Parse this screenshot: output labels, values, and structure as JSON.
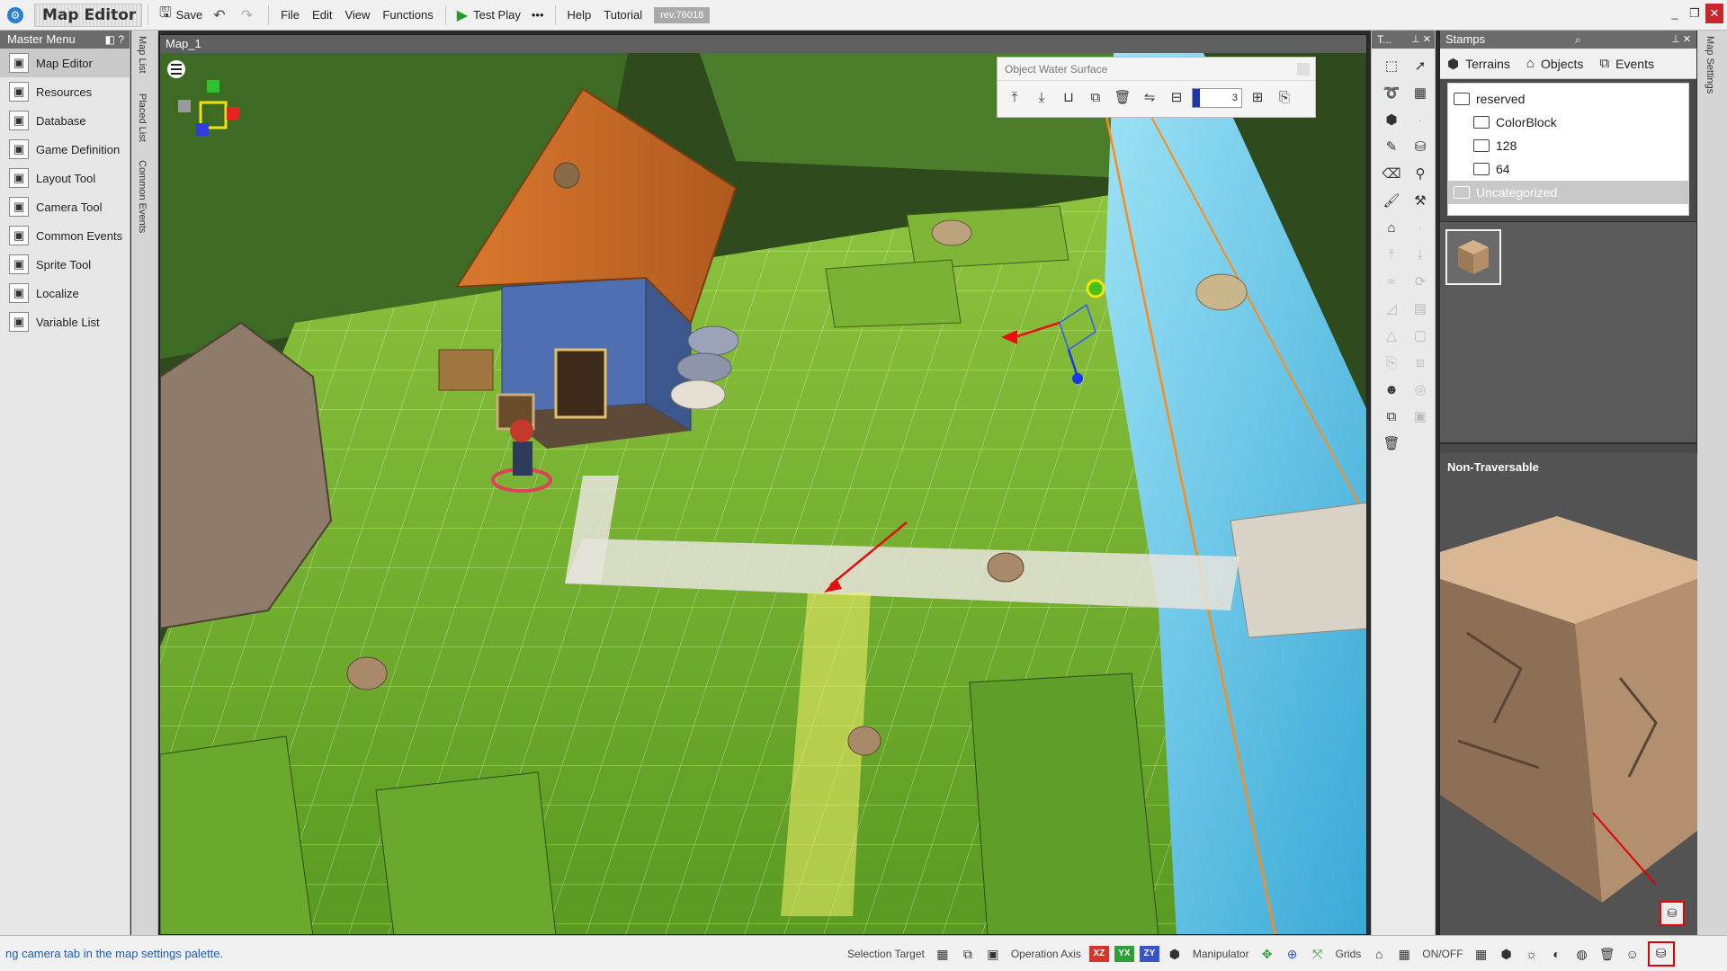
{
  "titlebar": {
    "app_title": "Map Editor",
    "save_label": "Save",
    "menus": [
      "File",
      "Edit",
      "View",
      "Functions"
    ],
    "test_play_label": "Test Play",
    "more_label": "•••",
    "help_label": "Help",
    "tutorial_label": "Tutorial",
    "revision": "rev.76018",
    "window_controls": [
      "_",
      "❐",
      "✕"
    ]
  },
  "master_menu": {
    "title": "Master Menu",
    "items": [
      {
        "label": "Map Editor",
        "icon": "map-icon",
        "selected": true
      },
      {
        "label": "Resources",
        "icon": "resources-icon"
      },
      {
        "label": "Database",
        "icon": "database-icon"
      },
      {
        "label": "Game Definition",
        "icon": "game-definition-icon"
      },
      {
        "label": "Layout Tool",
        "icon": "layout-icon"
      },
      {
        "label": "Camera Tool",
        "icon": "camera-icon"
      },
      {
        "label": "Common Events",
        "icon": "common-events-icon"
      },
      {
        "label": "Sprite Tool",
        "icon": "sprite-icon"
      },
      {
        "label": "Localize",
        "icon": "localize-icon"
      },
      {
        "label": "Variable List",
        "icon": "variable-icon"
      }
    ]
  },
  "vertical_tabs": [
    "Map List",
    "Placed List",
    "Common Events"
  ],
  "viewport": {
    "title": "Map_1",
    "water_panel": {
      "title": "Object Water Surface",
      "value": "3"
    }
  },
  "tools_panel": {
    "title": "T..."
  },
  "stamps": {
    "title": "Stamps",
    "tabs": [
      {
        "label": "Terrains",
        "icon": "terrain-icon"
      },
      {
        "label": "Objects",
        "icon": "objects-icon"
      },
      {
        "label": "Events",
        "icon": "events-icon"
      }
    ],
    "tree": [
      {
        "label": "reserved",
        "level": 0
      },
      {
        "label": "ColorBlock",
        "level": 1
      },
      {
        "label": "128",
        "level": 1
      },
      {
        "label": "64",
        "level": 1
      },
      {
        "label": "Uncategorized",
        "level": 0,
        "selected": true
      }
    ],
    "preview_label": "Non-Traversable"
  },
  "right_strip": {
    "label": "Map Settings"
  },
  "statusbar": {
    "message": "ng camera tab in the map settings palette.",
    "selection_target": "Selection Target",
    "operation_axis": "Operation Axis",
    "axes": [
      "XZ",
      "YX",
      "ZY"
    ],
    "manipulator": "Manipulator",
    "grids": "Grids",
    "onoff": "ON/OFF"
  },
  "colors": {
    "accent_blue": "#1a5fb4",
    "highlight_red": "#e00000",
    "play_green": "#1f9b2c",
    "water": "#5fc3e6",
    "grass": "#6aa82e"
  }
}
